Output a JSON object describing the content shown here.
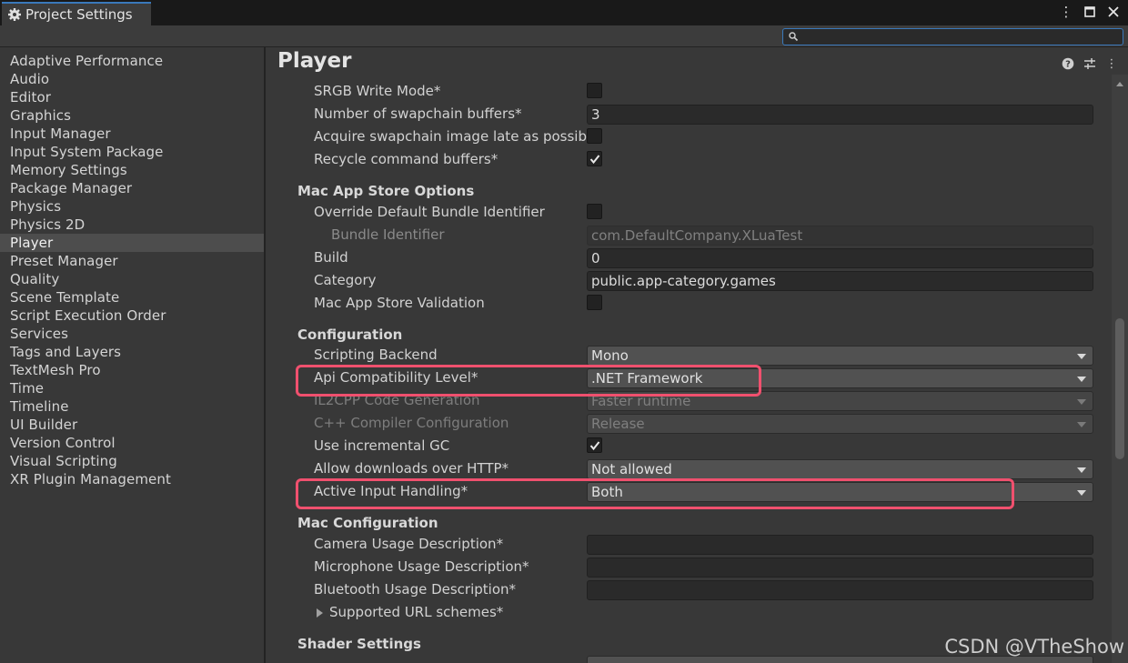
{
  "window": {
    "tab_title": "Project Settings",
    "search_placeholder": ""
  },
  "sidebar": {
    "items": [
      {
        "label": "Adaptive Performance"
      },
      {
        "label": "Audio"
      },
      {
        "label": "Editor"
      },
      {
        "label": "Graphics"
      },
      {
        "label": "Input Manager"
      },
      {
        "label": "Input System Package"
      },
      {
        "label": "Memory Settings"
      },
      {
        "label": "Package Manager"
      },
      {
        "label": "Physics"
      },
      {
        "label": "Physics 2D"
      },
      {
        "label": "Player",
        "selected": true
      },
      {
        "label": "Preset Manager"
      },
      {
        "label": "Quality"
      },
      {
        "label": "Scene Template"
      },
      {
        "label": "Script Execution Order"
      },
      {
        "label": "Services"
      },
      {
        "label": "Tags and Layers"
      },
      {
        "label": "TextMesh Pro"
      },
      {
        "label": "Time"
      },
      {
        "label": "Timeline"
      },
      {
        "label": "UI Builder"
      },
      {
        "label": "Version Control"
      },
      {
        "label": "Visual Scripting"
      },
      {
        "label": "XR Plugin Management"
      }
    ]
  },
  "main": {
    "title": "Player",
    "rows": {
      "srgb": {
        "label": "SRGB Write Mode*",
        "checked": false
      },
      "swapchain": {
        "label": "Number of swapchain buffers*",
        "value": "3"
      },
      "acquire": {
        "label": "Acquire swapchain image late as possible*",
        "checked": false
      },
      "recycle": {
        "label": "Recycle command buffers*",
        "checked": true
      }
    },
    "mac_app_store": {
      "header": "Mac App Store Options",
      "override": {
        "label": "Override Default Bundle Identifier",
        "checked": false
      },
      "bundle_id": {
        "label": "Bundle Identifier",
        "value": "com.DefaultCompany.XLuaTest"
      },
      "build": {
        "label": "Build",
        "value": "0"
      },
      "category": {
        "label": "Category",
        "value": "public.app-category.games"
      },
      "validation": {
        "label": "Mac App Store Validation",
        "checked": false
      }
    },
    "configuration": {
      "header": "Configuration",
      "scripting_backend": {
        "label": "Scripting Backend",
        "value": "Mono"
      },
      "api_level": {
        "label": "Api Compatibility Level*",
        "value": ".NET Framework"
      },
      "il2cpp": {
        "label": "IL2CPP Code Generation",
        "value": "Faster runtime"
      },
      "cpp_compiler": {
        "label": "C++ Compiler Configuration",
        "value": "Release"
      },
      "incremental_gc": {
        "label": "Use incremental GC",
        "checked": true
      },
      "downloads_http": {
        "label": "Allow downloads over HTTP*",
        "value": "Not allowed"
      },
      "input_handling": {
        "label": "Active Input Handling*",
        "value": "Both"
      }
    },
    "mac_configuration": {
      "header": "Mac Configuration",
      "camera": {
        "label": "Camera Usage Description*",
        "value": ""
      },
      "microphone": {
        "label": "Microphone Usage Description*",
        "value": ""
      },
      "bluetooth": {
        "label": "Bluetooth Usage Description*",
        "value": ""
      },
      "url_schemes": {
        "label": "Supported URL schemes*"
      }
    },
    "shader_settings": {
      "header": "Shader Settings"
    }
  },
  "colors": {
    "accent": "#3a79bb",
    "highlight": "#f0506e",
    "background": "#383838"
  },
  "watermark": "CSDN @VTheShow"
}
